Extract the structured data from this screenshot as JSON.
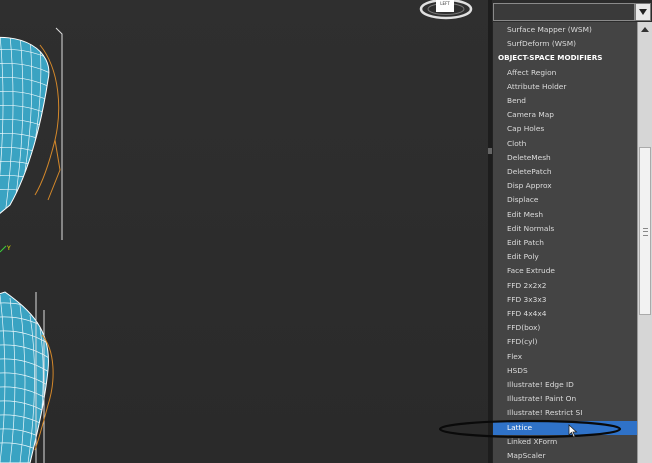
{
  "modifier_list": {
    "items": [
      {
        "label": "Surface Mapper (WSM)",
        "type": "item"
      },
      {
        "label": "SurfDeform (WSM)",
        "type": "item"
      },
      {
        "label": "OBJECT-SPACE MODIFIERS",
        "type": "header"
      },
      {
        "label": "Affect Region",
        "type": "item"
      },
      {
        "label": "Attribute Holder",
        "type": "item"
      },
      {
        "label": "Bend",
        "type": "item"
      },
      {
        "label": "Camera Map",
        "type": "item"
      },
      {
        "label": "Cap Holes",
        "type": "item"
      },
      {
        "label": "Cloth",
        "type": "item"
      },
      {
        "label": "DeleteMesh",
        "type": "item"
      },
      {
        "label": "DeletePatch",
        "type": "item"
      },
      {
        "label": "Disp Approx",
        "type": "item"
      },
      {
        "label": "Displace",
        "type": "item"
      },
      {
        "label": "Edit Mesh",
        "type": "item"
      },
      {
        "label": "Edit Normals",
        "type": "item"
      },
      {
        "label": "Edit Patch",
        "type": "item"
      },
      {
        "label": "Edit Poly",
        "type": "item"
      },
      {
        "label": "Face Extrude",
        "type": "item"
      },
      {
        "label": "FFD 2x2x2",
        "type": "item"
      },
      {
        "label": "FFD 3x3x3",
        "type": "item"
      },
      {
        "label": "FFD 4x4x4",
        "type": "item"
      },
      {
        "label": "FFD(box)",
        "type": "item"
      },
      {
        "label": "FFD(cyl)",
        "type": "item"
      },
      {
        "label": "Flex",
        "type": "item"
      },
      {
        "label": "HSDS",
        "type": "item"
      },
      {
        "label": "Illustrate! Edge ID",
        "type": "item"
      },
      {
        "label": "Illustrate! Paint On",
        "type": "item"
      },
      {
        "label": "Illustrate! Restrict SI",
        "type": "item"
      },
      {
        "label": "Lattice",
        "type": "selected"
      },
      {
        "label": "Linked XForm",
        "type": "item"
      },
      {
        "label": "MapScaler",
        "type": "item"
      }
    ]
  },
  "viewport": {
    "axis_label": "Y",
    "viewcube_label": "LEFT"
  },
  "colors": {
    "selection": "#2f72c8",
    "object": "#3aa3c2",
    "bbox": "#d4882a"
  }
}
